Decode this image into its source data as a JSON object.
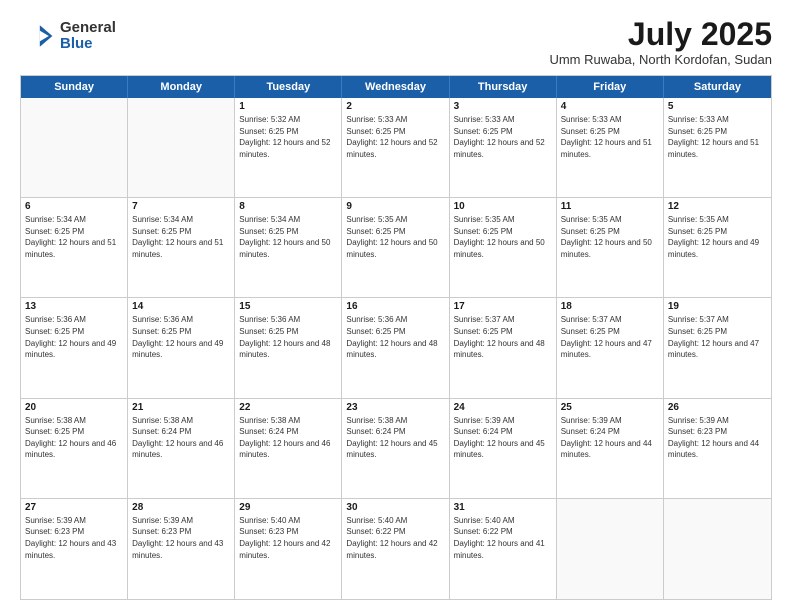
{
  "logo": {
    "general": "General",
    "blue": "Blue"
  },
  "header": {
    "month_year": "July 2025",
    "location": "Umm Ruwaba, North Kordofan, Sudan"
  },
  "weekdays": [
    "Sunday",
    "Monday",
    "Tuesday",
    "Wednesday",
    "Thursday",
    "Friday",
    "Saturday"
  ],
  "weeks": [
    [
      {
        "day": "",
        "info": ""
      },
      {
        "day": "",
        "info": ""
      },
      {
        "day": "1",
        "info": "Sunrise: 5:32 AM\nSunset: 6:25 PM\nDaylight: 12 hours and 52 minutes."
      },
      {
        "day": "2",
        "info": "Sunrise: 5:33 AM\nSunset: 6:25 PM\nDaylight: 12 hours and 52 minutes."
      },
      {
        "day": "3",
        "info": "Sunrise: 5:33 AM\nSunset: 6:25 PM\nDaylight: 12 hours and 52 minutes."
      },
      {
        "day": "4",
        "info": "Sunrise: 5:33 AM\nSunset: 6:25 PM\nDaylight: 12 hours and 51 minutes."
      },
      {
        "day": "5",
        "info": "Sunrise: 5:33 AM\nSunset: 6:25 PM\nDaylight: 12 hours and 51 minutes."
      }
    ],
    [
      {
        "day": "6",
        "info": "Sunrise: 5:34 AM\nSunset: 6:25 PM\nDaylight: 12 hours and 51 minutes."
      },
      {
        "day": "7",
        "info": "Sunrise: 5:34 AM\nSunset: 6:25 PM\nDaylight: 12 hours and 51 minutes."
      },
      {
        "day": "8",
        "info": "Sunrise: 5:34 AM\nSunset: 6:25 PM\nDaylight: 12 hours and 50 minutes."
      },
      {
        "day": "9",
        "info": "Sunrise: 5:35 AM\nSunset: 6:25 PM\nDaylight: 12 hours and 50 minutes."
      },
      {
        "day": "10",
        "info": "Sunrise: 5:35 AM\nSunset: 6:25 PM\nDaylight: 12 hours and 50 minutes."
      },
      {
        "day": "11",
        "info": "Sunrise: 5:35 AM\nSunset: 6:25 PM\nDaylight: 12 hours and 50 minutes."
      },
      {
        "day": "12",
        "info": "Sunrise: 5:35 AM\nSunset: 6:25 PM\nDaylight: 12 hours and 49 minutes."
      }
    ],
    [
      {
        "day": "13",
        "info": "Sunrise: 5:36 AM\nSunset: 6:25 PM\nDaylight: 12 hours and 49 minutes."
      },
      {
        "day": "14",
        "info": "Sunrise: 5:36 AM\nSunset: 6:25 PM\nDaylight: 12 hours and 49 minutes."
      },
      {
        "day": "15",
        "info": "Sunrise: 5:36 AM\nSunset: 6:25 PM\nDaylight: 12 hours and 48 minutes."
      },
      {
        "day": "16",
        "info": "Sunrise: 5:36 AM\nSunset: 6:25 PM\nDaylight: 12 hours and 48 minutes."
      },
      {
        "day": "17",
        "info": "Sunrise: 5:37 AM\nSunset: 6:25 PM\nDaylight: 12 hours and 48 minutes."
      },
      {
        "day": "18",
        "info": "Sunrise: 5:37 AM\nSunset: 6:25 PM\nDaylight: 12 hours and 47 minutes."
      },
      {
        "day": "19",
        "info": "Sunrise: 5:37 AM\nSunset: 6:25 PM\nDaylight: 12 hours and 47 minutes."
      }
    ],
    [
      {
        "day": "20",
        "info": "Sunrise: 5:38 AM\nSunset: 6:25 PM\nDaylight: 12 hours and 46 minutes."
      },
      {
        "day": "21",
        "info": "Sunrise: 5:38 AM\nSunset: 6:24 PM\nDaylight: 12 hours and 46 minutes."
      },
      {
        "day": "22",
        "info": "Sunrise: 5:38 AM\nSunset: 6:24 PM\nDaylight: 12 hours and 46 minutes."
      },
      {
        "day": "23",
        "info": "Sunrise: 5:38 AM\nSunset: 6:24 PM\nDaylight: 12 hours and 45 minutes."
      },
      {
        "day": "24",
        "info": "Sunrise: 5:39 AM\nSunset: 6:24 PM\nDaylight: 12 hours and 45 minutes."
      },
      {
        "day": "25",
        "info": "Sunrise: 5:39 AM\nSunset: 6:24 PM\nDaylight: 12 hours and 44 minutes."
      },
      {
        "day": "26",
        "info": "Sunrise: 5:39 AM\nSunset: 6:23 PM\nDaylight: 12 hours and 44 minutes."
      }
    ],
    [
      {
        "day": "27",
        "info": "Sunrise: 5:39 AM\nSunset: 6:23 PM\nDaylight: 12 hours and 43 minutes."
      },
      {
        "day": "28",
        "info": "Sunrise: 5:39 AM\nSunset: 6:23 PM\nDaylight: 12 hours and 43 minutes."
      },
      {
        "day": "29",
        "info": "Sunrise: 5:40 AM\nSunset: 6:23 PM\nDaylight: 12 hours and 42 minutes."
      },
      {
        "day": "30",
        "info": "Sunrise: 5:40 AM\nSunset: 6:22 PM\nDaylight: 12 hours and 42 minutes."
      },
      {
        "day": "31",
        "info": "Sunrise: 5:40 AM\nSunset: 6:22 PM\nDaylight: 12 hours and 41 minutes."
      },
      {
        "day": "",
        "info": ""
      },
      {
        "day": "",
        "info": ""
      }
    ]
  ]
}
